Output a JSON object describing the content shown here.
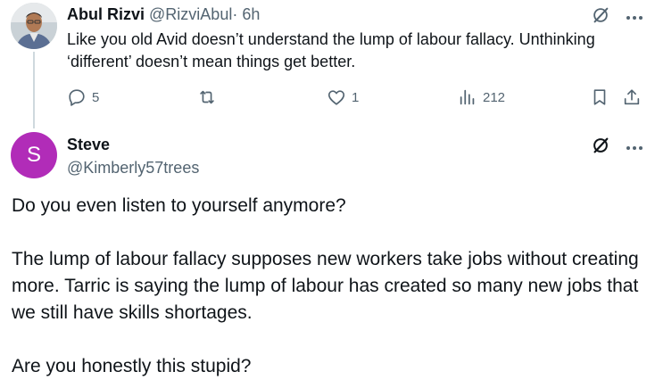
{
  "reply": {
    "author_name": "Abul Rizvi",
    "author_handle": "@RizviAbul",
    "separator": "·",
    "time": "6h",
    "text": "Like you old Avid doesn’t understand the lump of labour fallacy. Unthinking ‘different’ doesn’t mean things get better.",
    "stats": {
      "replies": "5",
      "retweets": "",
      "likes": "1",
      "views": "212"
    }
  },
  "main_post": {
    "avatar_letter": "S",
    "avatar_color": "#b12cb8",
    "author_name": "Steve",
    "author_handle": "@Kimberly57trees",
    "paragraphs": [
      "Do you even listen to yourself anymore?",
      "The lump of labour fallacy supposes new workers take jobs without creating more. Tarric is saying the lump of labour has created so many new jobs that we still have skills shortages.",
      "Are you honestly this stupid?"
    ]
  },
  "colors": {
    "text": "#0f1419",
    "muted": "#536471",
    "thread_line": "#cfd9de"
  },
  "icons": [
    "grok-icon",
    "more-icon",
    "reply-icon",
    "retweet-icon",
    "like-icon",
    "views-icon",
    "bookmark-icon",
    "share-icon"
  ]
}
